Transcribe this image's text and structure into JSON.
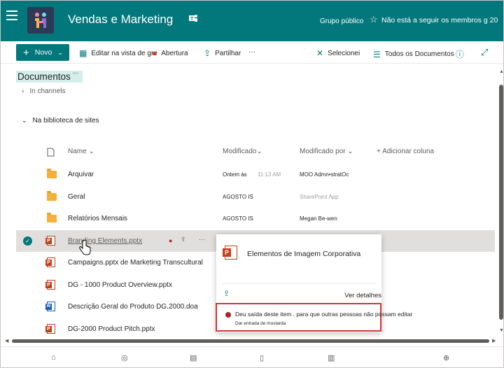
{
  "header": {
    "site_title": "Vendas e Marketing",
    "group_type": "Grupo público",
    "follow_text": "Não está a seguir os membros g 20",
    "colors": {
      "suite_bg": "#03787c",
      "logo_bg": "#2b3a55"
    }
  },
  "commandbar": {
    "new_label": "Novo",
    "edit_grid_label": "Editar na vista de gre",
    "open_label": "Abertura",
    "share_label": "Partilhar",
    "more_label": "···",
    "select_label": "Selecionei",
    "view_label": "Todos os Documentos"
  },
  "library": {
    "title": "Documentos",
    "title_sup": "~~",
    "channels_label": "In channels",
    "section_label": "Na biblioteca de sites"
  },
  "columns": {
    "name": "Name",
    "modified": "Modificado",
    "modified_by": "Modificado por",
    "add_column": "Adicionar coluna"
  },
  "rows": [
    {
      "name": "Arquivar",
      "type": "folder",
      "modified": "Ontem às",
      "time": "11:13 AM",
      "modified_by": "MOO Admn•stratOc",
      "muted": false
    },
    {
      "name": "Geral",
      "type": "folder",
      "modified": "AGOSTO IS",
      "time": "",
      "modified_by": "SharePoint App",
      "muted": true
    },
    {
      "name": "Relatórios Mensais",
      "type": "folder",
      "modified": "AGOSTO IS",
      "time": "",
      "modified_by": "Megan Be-wen",
      "muted": false
    },
    {
      "name": "Branding Elements.pptx",
      "type": "ppt",
      "modified": "",
      "time": "",
      "modified_by": "",
      "muted": false,
      "selected": true
    },
    {
      "name": "Campaigns.pptx de Marketing Transcultural",
      "type": "ppt",
      "modified": "",
      "time": "",
      "modified_by": "",
      "muted": false
    },
    {
      "name": "DG - 1000 Product Overview.pptx",
      "type": "ppt",
      "modified": "",
      "time": "",
      "modified_by": "",
      "muted": false
    },
    {
      "name": "Descrição Geral do Produto DG.2000.doa",
      "type": "doc",
      "modified": "",
      "time": "",
      "modified_by": "",
      "muted": false
    },
    {
      "name": "DG-2000 Product Pitch.pptx",
      "type": "ppt",
      "modified": "",
      "time": "",
      "modified_by": "",
      "muted": false
    }
  ],
  "callout": {
    "file_title": "Elementos de Imagem Corporativa",
    "see_details": "Ver detalhes",
    "alert_text": "Deu saída deste item . para que outras pessoas não possam editar",
    "alert_action": "Dar entrada de mostarda"
  }
}
